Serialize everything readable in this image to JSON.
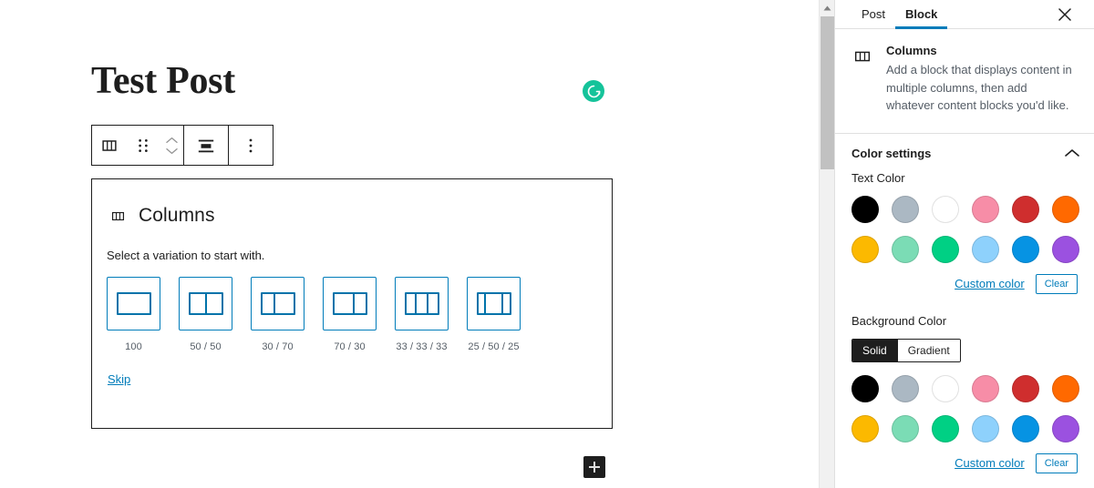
{
  "editor": {
    "post_title": "Test Post",
    "grammarly_badge_letter": "G",
    "grammarly_badge_color": "#15c39a",
    "toolbar": {
      "block_type_label": "Columns",
      "drag_handle_label": "Drag",
      "move_up_label": "Move up",
      "move_down_label": "Move down",
      "align_label": "Change alignment",
      "more_options_label": "Options"
    },
    "columns_block": {
      "title": "Columns",
      "instructions": "Select a variation to start with.",
      "skip_label": "Skip",
      "variations": [
        {
          "label": "100",
          "segments": [
            100
          ]
        },
        {
          "label": "50 / 50",
          "segments": [
            50,
            50
          ]
        },
        {
          "label": "30 / 70",
          "segments": [
            40,
            60
          ]
        },
        {
          "label": "70 / 30",
          "segments": [
            64,
            36
          ]
        },
        {
          "label": "33 / 33 / 33",
          "segments": [
            33,
            34,
            33
          ]
        },
        {
          "label": "25 / 50 / 25",
          "segments": [
            22,
            56,
            22
          ]
        }
      ]
    },
    "inserter_label": "+"
  },
  "sidebar": {
    "tabs": [
      {
        "label": "Post",
        "active": false
      },
      {
        "label": "Block",
        "active": true
      }
    ],
    "close_label": "Close settings",
    "block_card": {
      "title": "Columns",
      "description": "Add a block that displays content in multiple columns, then add whatever content blocks you'd like."
    },
    "color_panel": {
      "title": "Color settings",
      "expanded": true,
      "text_color": {
        "label": "Text Color",
        "swatches": [
          "#000000",
          "#abb8c3",
          "#ffffff",
          "#f78da7",
          "#cf2e2e",
          "#ff6900",
          "#fcb900",
          "#7bdcb5",
          "#00d084",
          "#8ed1fc",
          "#0693e3",
          "#9b51e0"
        ],
        "custom_color_label": "Custom color",
        "clear_label": "Clear"
      },
      "background_color": {
        "label": "Background Color",
        "solid_label": "Solid",
        "gradient_label": "Gradient",
        "active_mode": "Solid",
        "swatches": [
          "#000000",
          "#abb8c3",
          "#ffffff",
          "#f78da7",
          "#cf2e2e",
          "#ff6900",
          "#fcb900",
          "#7bdcb5",
          "#00d084",
          "#8ed1fc",
          "#0693e3",
          "#9b51e0"
        ],
        "custom_color_label": "Custom color",
        "clear_label": "Clear"
      }
    },
    "accent_color": "#007cba"
  }
}
